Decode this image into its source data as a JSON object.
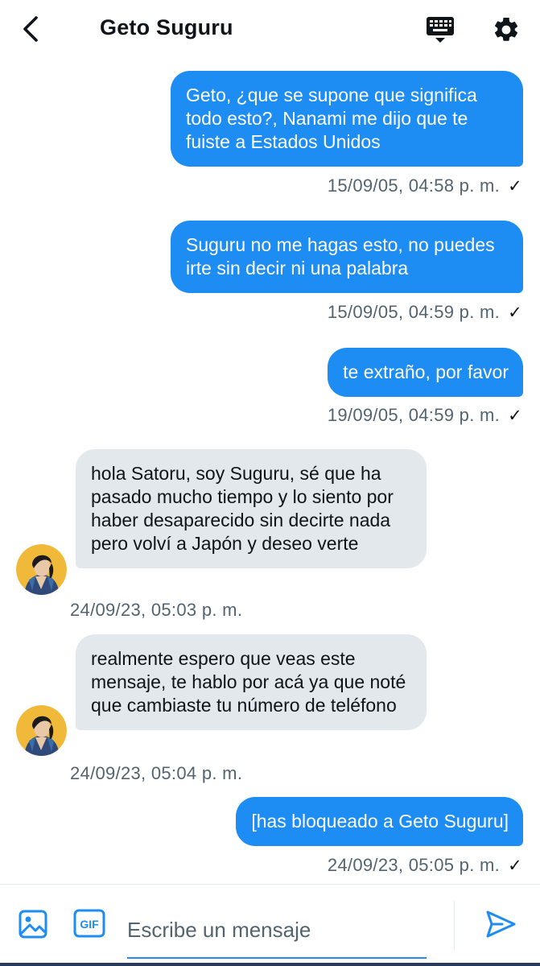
{
  "header": {
    "title": "Geto Suguru",
    "back_icon": "chevron-left-icon",
    "keyboard_icon": "keyboard-icon",
    "settings_icon": "gear-icon"
  },
  "colors": {
    "outgoing_bubble": "#1d8cf3",
    "incoming_bubble": "#e3e8ed",
    "meta_text": "#536471",
    "accent": "#1d8cf3"
  },
  "messages": [
    {
      "direction": "outgoing",
      "text": "Geto, ¿que se supone que significa todo esto?, Nanami me dijo que te fuiste a Estados Unidos",
      "timestamp": "15/09/05, 04:58 p. m.",
      "status": "✓"
    },
    {
      "direction": "outgoing",
      "text": "Suguru no me hagas esto, no puedes irte sin decir ni una palabra",
      "timestamp": "15/09/05, 04:59 p. m.",
      "status": "✓"
    },
    {
      "direction": "outgoing",
      "text": "te extraño, por favor",
      "timestamp": "19/09/05, 04:59 p. m.",
      "status": "✓"
    },
    {
      "direction": "incoming",
      "text": "hola Satoru, soy Suguru, sé que ha pasado mucho tiempo y lo siento por haber desaparecido sin decirte nada pero volví a Japón y deseo verte",
      "timestamp": "24/09/23, 05:03 p. m."
    },
    {
      "direction": "incoming",
      "text": "realmente espero que veas este mensaje, te hablo por acá ya que noté que cambiaste tu número de teléfono",
      "timestamp": "24/09/23, 05:04 p. m."
    },
    {
      "direction": "outgoing",
      "text": "[has bloqueado a Geto Suguru]",
      "timestamp": "24/09/23, 05:05 p. m.",
      "status": "✓"
    }
  ],
  "composer": {
    "placeholder": "Escribe un mensaje",
    "image_icon": "image-icon",
    "gif_label": "GIF",
    "send_icon": "send-icon"
  }
}
